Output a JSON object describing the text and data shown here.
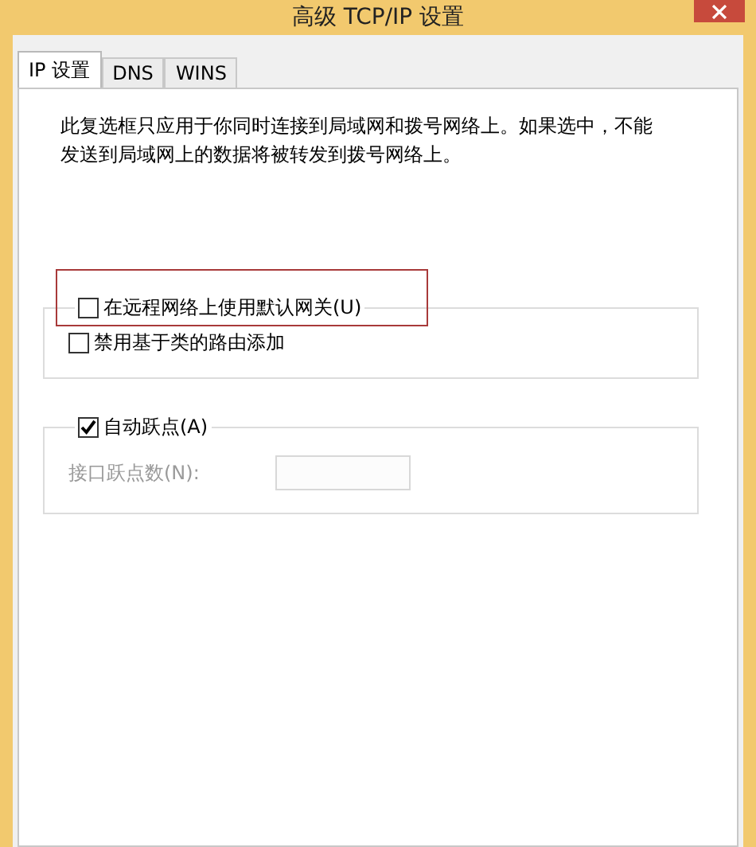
{
  "window": {
    "title": "高级 TCP/IP 设置"
  },
  "tabs": [
    {
      "label": "IP 设置",
      "selected": true
    },
    {
      "label": "DNS",
      "selected": false
    },
    {
      "label": "WINS",
      "selected": false
    }
  ],
  "description": "此复选框只应用于你同时连接到局域网和拨号网络上。如果选中，不能发送到局域网上的数据将被转发到拨号网络上。",
  "groups": [
    {
      "legend": {
        "label": "在远程网络上使用默认网关(U)",
        "checked": false,
        "highlighted": true
      },
      "items": [
        {
          "kind": "checkbox",
          "label": "禁用基于类的路由添加",
          "checked": false
        }
      ]
    },
    {
      "legend": {
        "label": "自动跃点(A)",
        "checked": true,
        "highlighted": false
      },
      "items": [
        {
          "kind": "field",
          "label": "接口跃点数(N):",
          "disabled": true
        }
      ]
    }
  ]
}
